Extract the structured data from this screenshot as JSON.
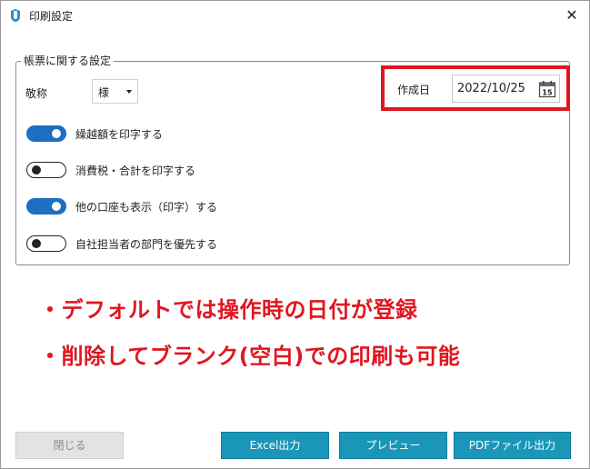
{
  "window": {
    "title": "印刷設定",
    "close_glyph": "✕"
  },
  "group": {
    "legend": "帳票に関する設定"
  },
  "honorific": {
    "label": "敬称",
    "selected": "様"
  },
  "created_date": {
    "label": "作成日",
    "value": "2022/10/25",
    "calendar_day": "15"
  },
  "toggles": [
    {
      "label": "繰越額を印字する",
      "on": true
    },
    {
      "label": "消費税・合計を印字する",
      "on": false
    },
    {
      "label": "他の口座も表示（印字）する",
      "on": true
    },
    {
      "label": "自社担当者の部門を優先する",
      "on": false
    }
  ],
  "notes": [
    "・デフォルトでは操作時の日付が登録",
    "・削除してブランク(空白)での印刷も可能"
  ],
  "buttons": {
    "close": "閉じる",
    "excel": "Excel出力",
    "preview": "プレビュー",
    "pdf": "PDFファイル出力"
  },
  "colors": {
    "accent_blue": "#1c6fc3",
    "button_teal": "#1a96b8",
    "highlight_red": "#e0161f"
  },
  "icons": {
    "app": "app-logo-icon",
    "calendar": "calendar-icon",
    "close": "close-icon",
    "dropdown": "chevron-down-icon"
  }
}
